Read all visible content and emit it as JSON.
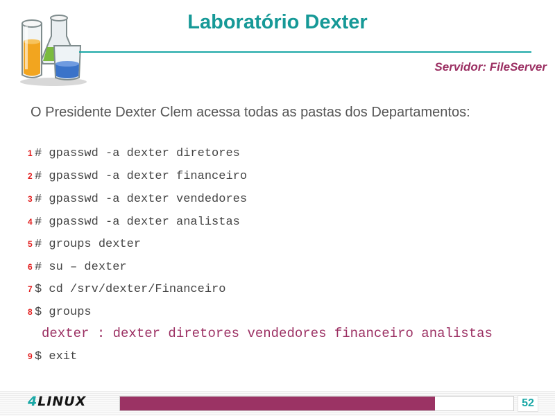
{
  "header": {
    "title": "Laboratório Dexter",
    "server": "Servidor: FileServer"
  },
  "intro": "O Presidente Dexter Clem acessa todas as pastas dos Departamentos:",
  "commands": [
    {
      "num": "1",
      "text": "# gpasswd -a dexter diretores"
    },
    {
      "num": "2",
      "text": "# gpasswd -a dexter financeiro"
    },
    {
      "num": "3",
      "text": "# gpasswd -a dexter vendedores"
    },
    {
      "num": "4",
      "text": "# gpasswd -a dexter analistas"
    },
    {
      "num": "5",
      "text": "# groups dexter"
    },
    {
      "num": "6",
      "text": "# su – dexter"
    },
    {
      "num": "7",
      "text": "$ cd /srv/dexter/Financeiro"
    },
    {
      "num": "8",
      "text": "$ groups"
    },
    {
      "num": "9",
      "text": "$ exit"
    }
  ],
  "output": "dexter : dexter diretores vendedores financeiro analistas",
  "footer": {
    "brand_four": "4",
    "brand_rest": "LINUX",
    "progress": 0.8,
    "page_number": "52"
  },
  "colors": {
    "title": "#169997",
    "accent": "#9b2f62",
    "line_number": "#e21d1d"
  }
}
